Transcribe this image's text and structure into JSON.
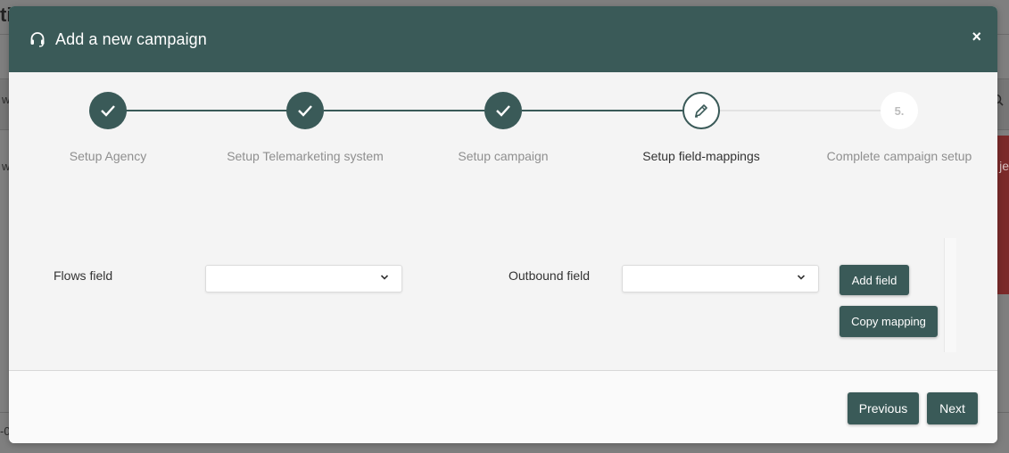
{
  "background": {
    "title_fragment": "ti",
    "band_text": "w",
    "side_text": "w",
    "red_text": "je",
    "bottom_text": "-0"
  },
  "modal": {
    "title": "Add a new campaign",
    "icon": "headset-icon",
    "close_label": "×",
    "accent": "#3a5a58"
  },
  "stepper": {
    "steps": [
      {
        "label": "Setup Agency",
        "state": "done",
        "marker": ""
      },
      {
        "label": "Setup Telemarketing system",
        "state": "done",
        "marker": ""
      },
      {
        "label": "Setup campaign",
        "state": "done",
        "marker": ""
      },
      {
        "label": "Setup field-mappings",
        "state": "active",
        "marker": ""
      },
      {
        "label": "Complete campaign setup",
        "state": "todo",
        "marker": "5."
      }
    ]
  },
  "mapping": {
    "flows_label": "Flows field",
    "flows_value": "",
    "outbound_label": "Outbound field",
    "outbound_value": "",
    "add_field_label": "Add field",
    "copy_mapping_label": "Copy mapping"
  },
  "footer": {
    "previous_label": "Previous",
    "next_label": "Next"
  }
}
